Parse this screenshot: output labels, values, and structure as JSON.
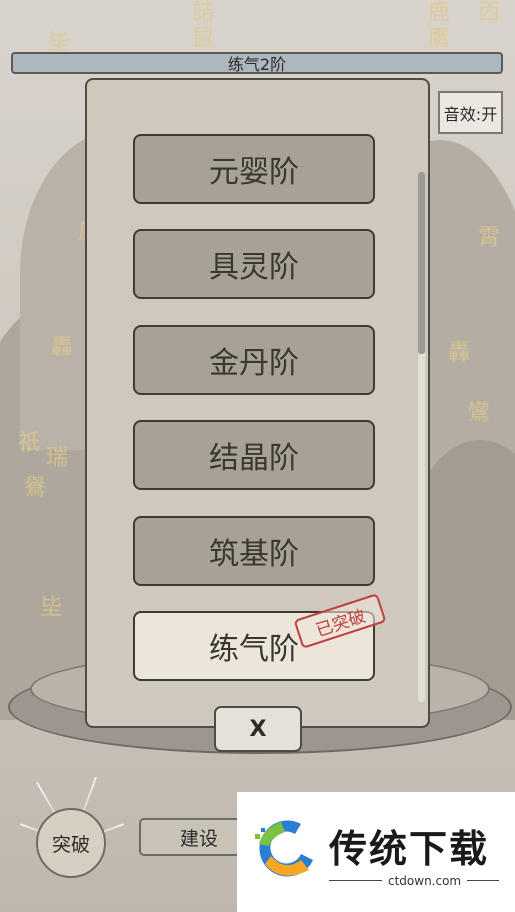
{
  "header": {
    "level_text": "练气2阶"
  },
  "settings": {
    "sound_label": "音效:开"
  },
  "realm_list": {
    "items": [
      {
        "label": "元婴阶"
      },
      {
        "label": "具灵阶"
      },
      {
        "label": "金丹阶"
      },
      {
        "label": "结晶阶"
      },
      {
        "label": "筑基阶"
      },
      {
        "label": "练气阶"
      }
    ],
    "stamp_text": "已突破",
    "close_label": "X"
  },
  "bottom_bar": {
    "breakthrough_label": "突破",
    "build_label": "建设"
  },
  "watermark": {
    "name": "传统下载",
    "url": "ctdown.com"
  },
  "colors": {
    "stamp_red": "#c04040",
    "glyph_gold": "#e0c98a"
  }
}
